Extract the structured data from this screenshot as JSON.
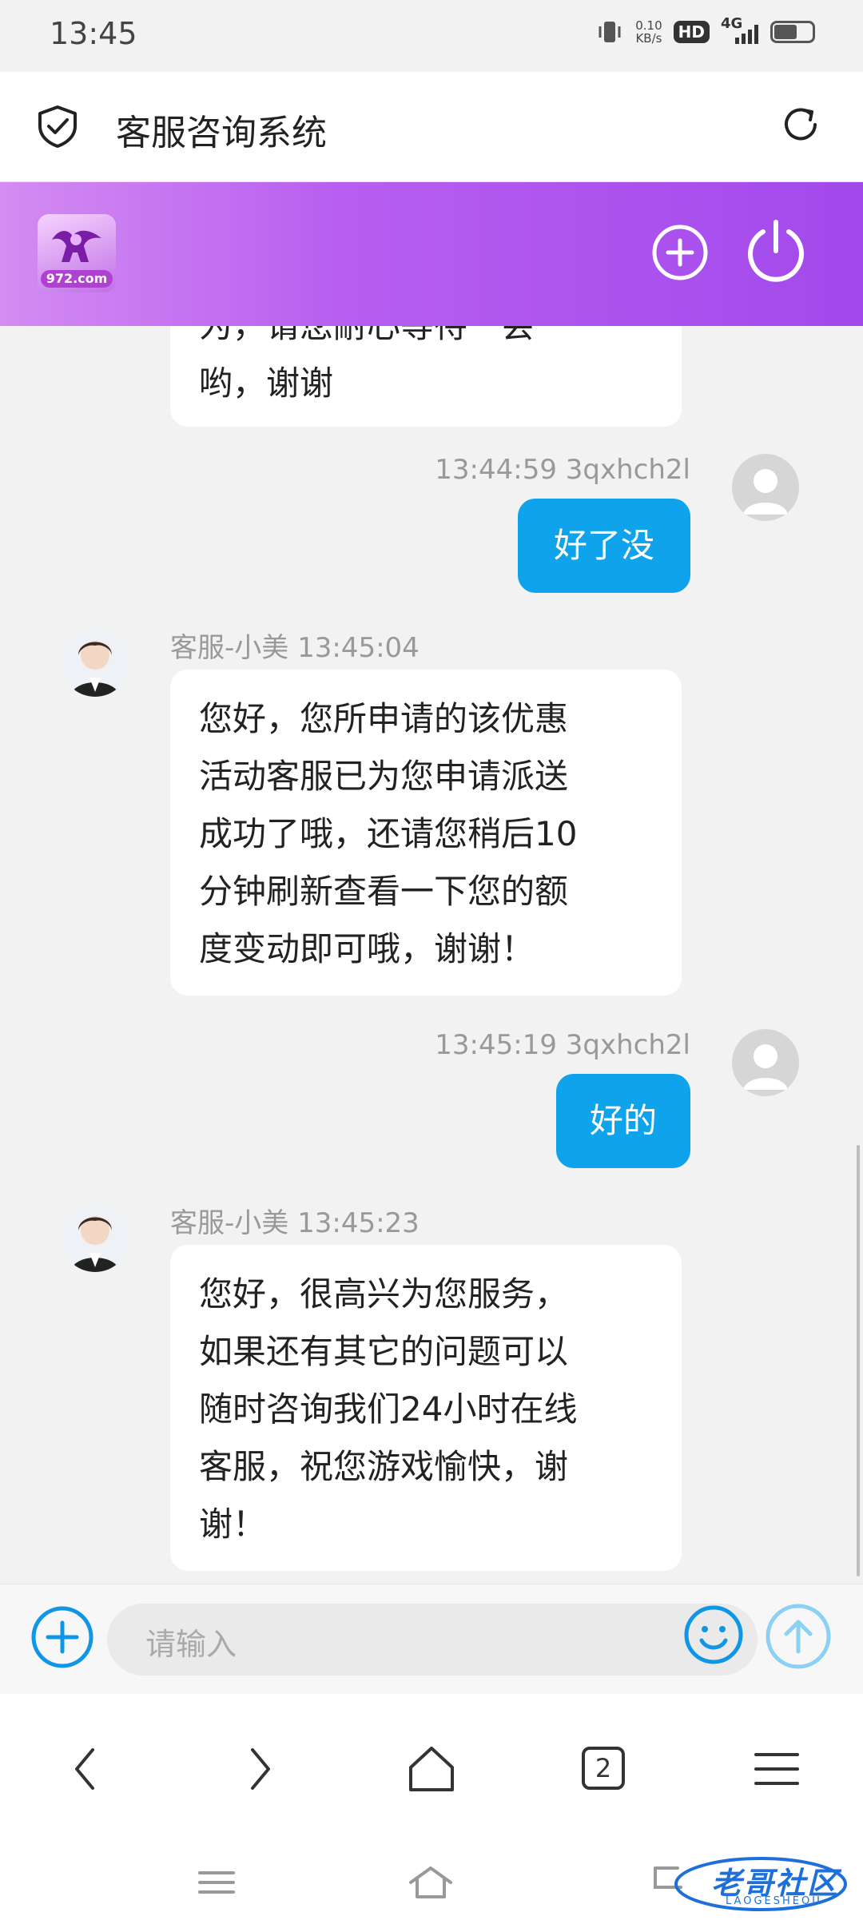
{
  "status_bar": {
    "time": "13:45",
    "net_speed_value": "0.10",
    "net_speed_unit": "KB/s",
    "hd_badge": "HD",
    "network": "4G",
    "battery_level": 0.55
  },
  "browser": {
    "title": "客服咨询系统",
    "tab_count": "2"
  },
  "app_header": {
    "logo_text": "972.com",
    "accent_start": "#d48cf2",
    "accent_end": "#a249ec"
  },
  "chat": {
    "messages": [
      {
        "side": "left",
        "lines": [
          "为，请您耐心等待一会",
          "哟，谢谢"
        ]
      },
      {
        "side": "right",
        "time": "13:44:59",
        "user": "3qxhch2l",
        "text": "好了没"
      },
      {
        "side": "left",
        "sender": "客服-小美",
        "time": "13:45:04",
        "lines": [
          "您好，您所申请的该优惠",
          "活动客服已为您申请派送",
          "成功了哦，还请您稍后10",
          "分钟刷新查看一下您的额",
          "度变动即可哦，谢谢！"
        ]
      },
      {
        "side": "right",
        "time": "13:45:19",
        "user": "3qxhch2l",
        "text": "好的"
      },
      {
        "side": "left",
        "sender": "客服-小美",
        "time": "13:45:23",
        "lines": [
          "您好，很高兴为您服务，",
          "如果还有其它的问题可以",
          "随时咨询我们24小时在线",
          "客服，祝您游戏愉快，谢",
          "谢！"
        ]
      }
    ],
    "user_bubble_color": "#0fa3ec"
  },
  "input": {
    "placeholder": "请输入"
  },
  "watermark": {
    "text": "老哥社区",
    "sub": "LAOGESHEOU"
  }
}
